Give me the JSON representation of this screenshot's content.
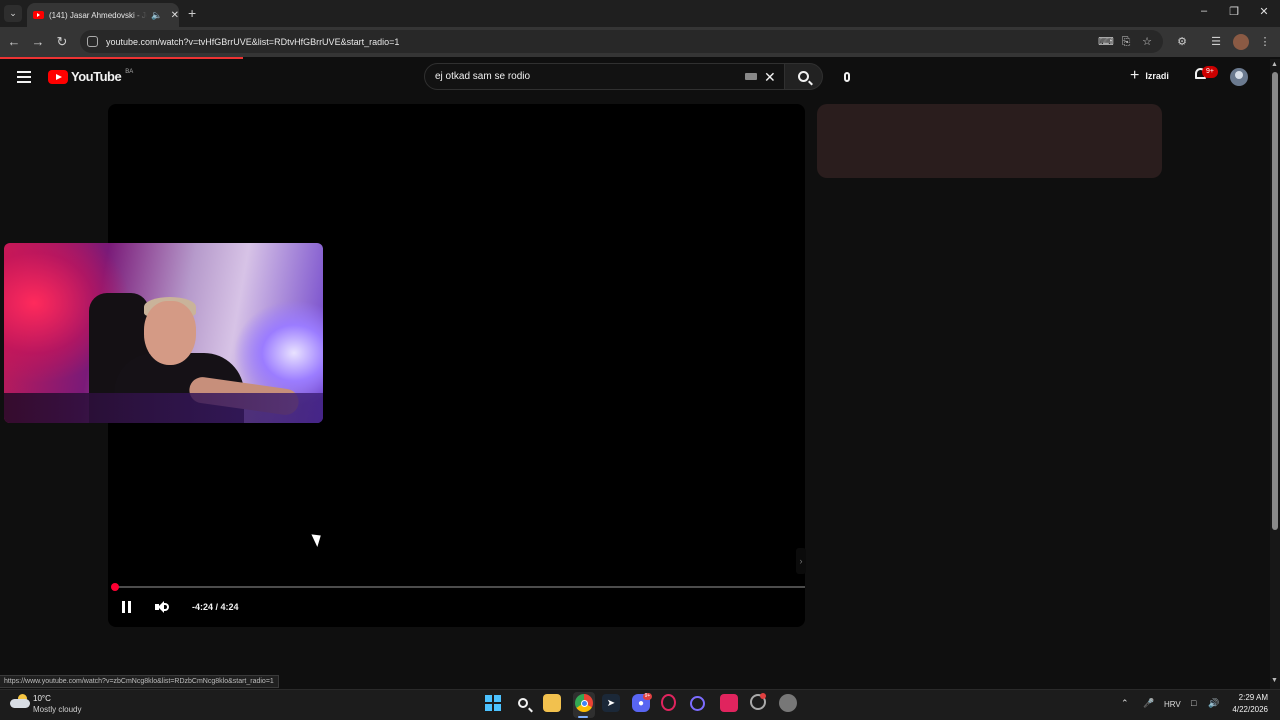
{
  "browser": {
    "tab_title": "(141) Jasar Ahmedovski - Jej",
    "tab_audio_icon": "speaker-icon",
    "url": "youtube.com/watch?v=tvHfGBrrUVE&list=RDtvHfGBrrUVE&start_radio=1",
    "status_url": "https://www.youtube.com/watch?v=zbCmNcg8klo&list=RDzbCmNcg8klo&start_radio=1"
  },
  "youtube": {
    "logo_text": "YouTube",
    "country_code": "BA",
    "search_query": "ej otkad sam se rodio",
    "create_label": "Izradi",
    "notification_count": "9+"
  },
  "player": {
    "time_display": "-4:24 / 4:24",
    "progress": 0,
    "state": "playing"
  },
  "taskbar": {
    "weather_temp": "10°C",
    "weather_desc": "Mostly cloudy",
    "language": "HRV",
    "time": "2:29 AM",
    "date": "4/22/2026",
    "apps": [
      "start-icon",
      "search-icon",
      "file-explorer-icon",
      "chrome-icon",
      "steam-icon",
      "discord-icon",
      "opera-gx-icon",
      "app-icon",
      "app-icon",
      "app-icon",
      "settings-icon"
    ],
    "discord_badge": "9+"
  },
  "colors": {
    "youtube_red": "#ff0000",
    "progress_red": "#ff0033",
    "page_bg": "#0f0f0f"
  }
}
